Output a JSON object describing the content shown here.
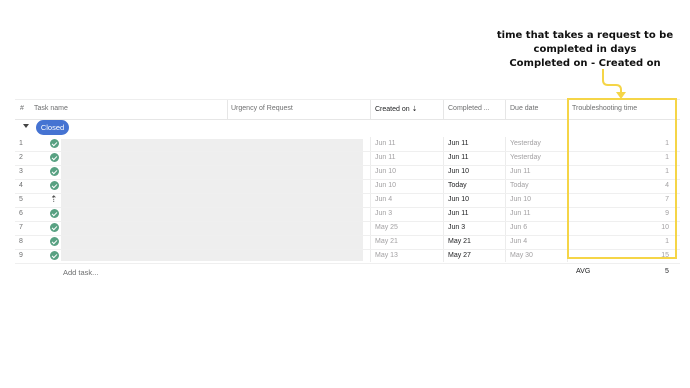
{
  "annotation": {
    "line1": "time that takes a request to be",
    "line2": "completed in days",
    "line3": "Completed on - Created on"
  },
  "colors": {
    "highlight": "#f5d547",
    "group_pill": "#4573d2",
    "check": "#58a182"
  },
  "header": {
    "hash": "#",
    "task_name": "Task name",
    "urgency": "Urgency of Request",
    "created_on": "Created on",
    "sort_icon": "sort-desc-icon",
    "completed": "Completed ...",
    "due_date": "Due date",
    "troubleshooting": "Troubleshooting time"
  },
  "group": {
    "label": "Closed"
  },
  "rows": [
    {
      "n": "1",
      "status": "check",
      "created": "Jun 11",
      "completed": "Jun 11",
      "due": "Yesterday",
      "tt": "1"
    },
    {
      "n": "2",
      "status": "check",
      "created": "Jun 11",
      "completed": "Jun 11",
      "due": "Yesterday",
      "tt": "1"
    },
    {
      "n": "3",
      "status": "check",
      "created": "Jun 10",
      "completed": "Jun 10",
      "due": "Jun 11",
      "tt": "1"
    },
    {
      "n": "4",
      "status": "check",
      "created": "Jun 10",
      "completed": "Today",
      "due": "Today",
      "tt": "4"
    },
    {
      "n": "5",
      "status": "arrow",
      "created": "Jun 4",
      "completed": "Jun 10",
      "due": "Jun 10",
      "tt": "7"
    },
    {
      "n": "6",
      "status": "check",
      "created": "Jun 3",
      "completed": "Jun 11",
      "due": "Jun 11",
      "tt": "9"
    },
    {
      "n": "7",
      "status": "check",
      "created": "May 25",
      "completed": "Jun 3",
      "due": "Jun 6",
      "tt": "10"
    },
    {
      "n": "8",
      "status": "check",
      "created": "May 21",
      "completed": "May 21",
      "due": "Jun 4",
      "tt": "1"
    },
    {
      "n": "9",
      "status": "check",
      "created": "May 13",
      "completed": "May 27",
      "due": "May 30",
      "tt": "15"
    }
  ],
  "footer": {
    "add_task": "Add task...",
    "avg_label": "AVG",
    "avg_value": "5"
  }
}
